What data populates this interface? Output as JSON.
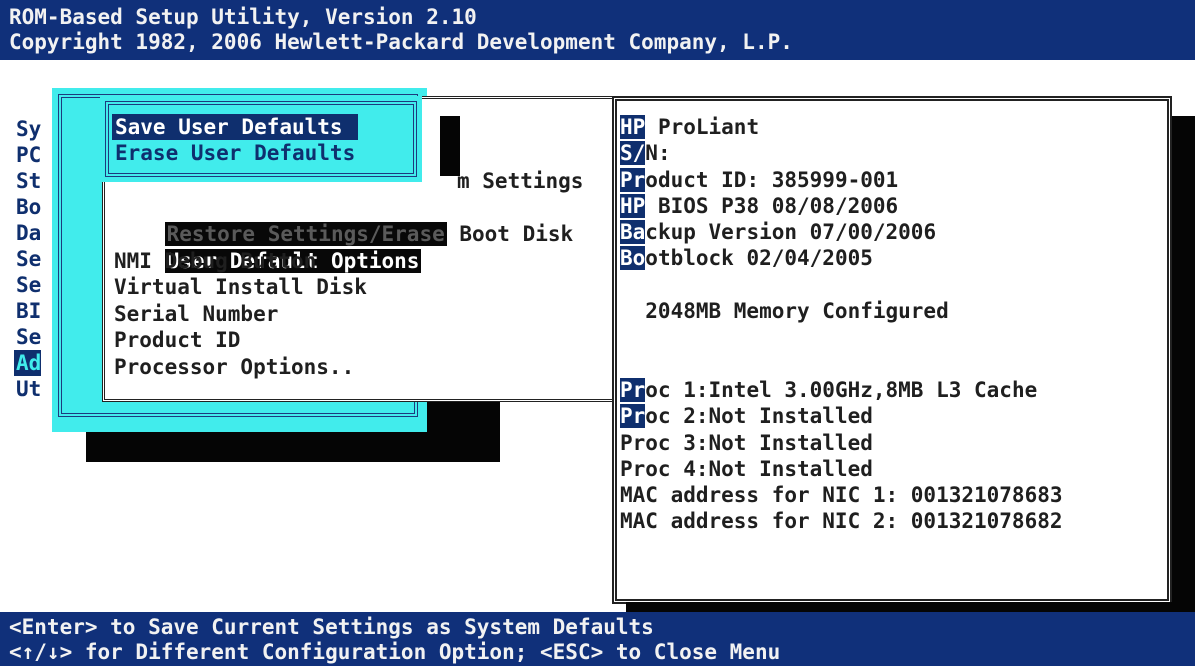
{
  "header": {
    "title": "ROM-Based Setup Utility, Version 2.10",
    "copyright": "Copyright 1982, 2006 Hewlett-Packard Development Company, L.P."
  },
  "main_menu": {
    "items": [
      "Sy",
      "PC",
      "St",
      "Bo",
      "Da",
      "Se",
      "Se",
      "BI",
      "Se",
      "Ad",
      "Ut"
    ],
    "selected_index": 9
  },
  "submenu": {
    "items": [
      {
        "head": "",
        "tail": "m Settings"
      },
      {
        "head": "Restore Settings/Erase",
        "tail": " Boot Disk"
      },
      {
        "head": "User Default Options",
        "tail": ""
      },
      {
        "head": "NMI Debug Button",
        "tail": ""
      },
      {
        "head": "Virtual Install Disk",
        "tail": ""
      },
      {
        "head": "Serial Number",
        "tail": ""
      },
      {
        "head": "Product ID",
        "tail": ""
      },
      {
        "head": "Processor Options..",
        "tail": ""
      }
    ]
  },
  "popup": {
    "items": [
      "Save User Defaults",
      "Erase User Defaults"
    ],
    "selected_index": 0
  },
  "info": {
    "lines": [
      {
        "pre": "HP",
        "rest": " ProLiant"
      },
      {
        "pre": "S/",
        "rest": "N:"
      },
      {
        "pre": "Pr",
        "rest": "oduct ID: 385999-001"
      },
      {
        "pre": "HP",
        "rest": " BIOS P38 08/08/2006"
      },
      {
        "pre": "Ba",
        "rest": "ckup Version 07/00/2006"
      },
      {
        "pre": "Bo",
        "rest": "otblock 02/04/2005"
      },
      {
        "pre": "",
        "rest": ""
      },
      {
        "pre": "",
        "rest": "  2048MB Memory Configured"
      },
      {
        "pre": "",
        "rest": ""
      },
      {
        "pre": "",
        "rest": ""
      },
      {
        "pre": "Pr",
        "rest": "oc 1:Intel 3.00GHz,8MB L3 Cache"
      },
      {
        "pre": "Pr",
        "rest": "oc 2:Not Installed"
      },
      {
        "pre": "",
        "rest": "Proc 3:Not Installed"
      },
      {
        "pre": "",
        "rest": "Proc 4:Not Installed"
      },
      {
        "pre": "",
        "rest": "MAC address for NIC 1: 001321078683"
      },
      {
        "pre": "",
        "rest": "MAC address for NIC 2: 001321078682"
      }
    ]
  },
  "footer": {
    "line1": "<Enter> to Save Current Settings as System Defaults",
    "line2": "<↑/↓> for Different Configuration Option; <ESC> to Close Menu"
  },
  "colors": {
    "bar": "#10307a",
    "cyan": "#41ecec",
    "selected": "#0f2f6e"
  }
}
